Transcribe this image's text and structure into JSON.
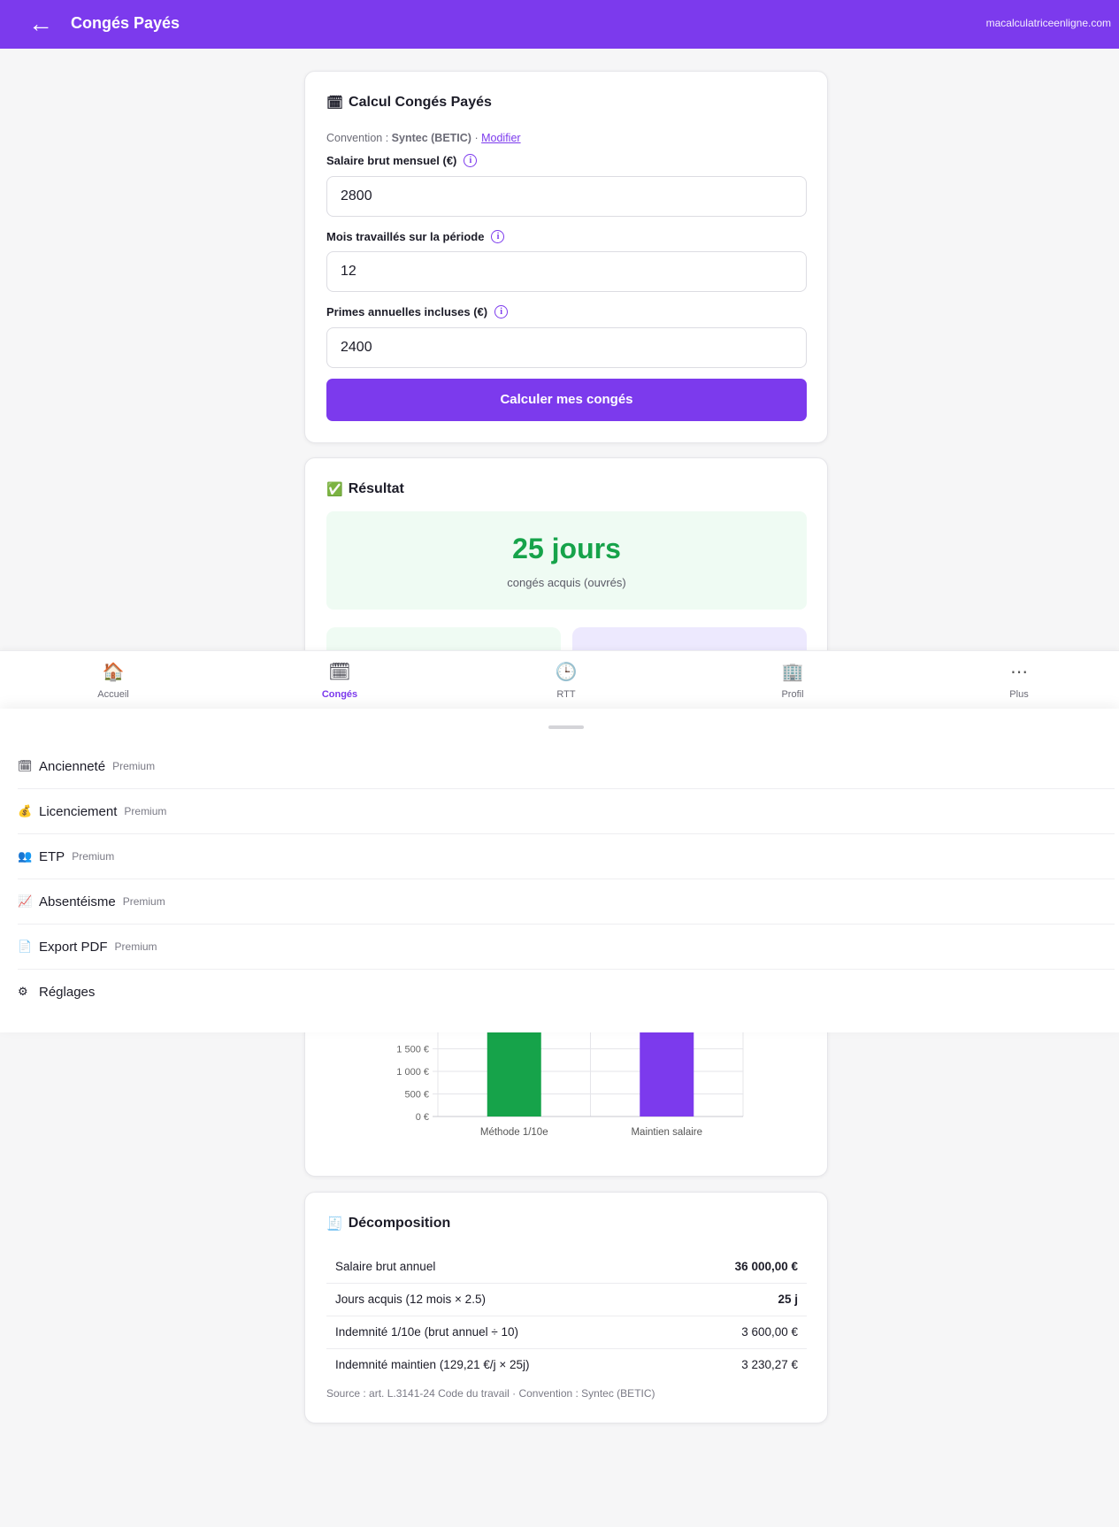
{
  "header": {
    "back_icon": "←",
    "title": "Congés Payés",
    "site": "macalculatriceenligne.com",
    "color": "#7c3aed"
  },
  "form": {
    "icon": "🗓",
    "title": "Calcul Congés Payés",
    "convention_prefix": "Convention :",
    "convention_name": "Syntec (BETIC)",
    "convention_sep": "·",
    "convention_link": "Modifier",
    "fields": [
      {
        "label": "Salaire brut mensuel (€)",
        "value": "2800"
      },
      {
        "label": "Mois travaillés sur la période",
        "value": "12"
      },
      {
        "label": "Primes annuelles incluses (€)",
        "value": "2400"
      }
    ],
    "info_icon": "i",
    "submit_label": "Calculer mes congés"
  },
  "result": {
    "icon": "✅",
    "title": "Résultat",
    "big_value": "25 jours",
    "subtitle": "congés acquis (ouvrés)"
  },
  "bottom_nav": [
    {
      "icon": "🏠",
      "label": "Accueil",
      "active": false
    },
    {
      "icon": "🗓",
      "label": "Congés",
      "active": true
    },
    {
      "icon": "🕒",
      "label": "RTT",
      "active": false
    },
    {
      "icon": "🏢",
      "label": "Profil",
      "active": false
    },
    {
      "icon": "⋯",
      "label": "Plus",
      "active": false
    }
  ],
  "more_menu": [
    {
      "icon": "🗓",
      "label": "Ancienneté",
      "badge": "Premium"
    },
    {
      "icon": "💰",
      "label": "Licenciement",
      "badge": "Premium"
    },
    {
      "icon": "👥",
      "label": "ETP",
      "badge": "Premium"
    },
    {
      "icon": "📈",
      "label": "Absentéisme",
      "badge": "Premium"
    },
    {
      "icon": "📄",
      "label": "Export PDF",
      "badge": "Premium"
    },
    {
      "icon": "⚙",
      "label": "Réglages",
      "badge": ""
    }
  ],
  "chart_data": {
    "type": "bar",
    "categories": [
      "Méthode 1/10e",
      "Maintien salaire"
    ],
    "values": [
      3600,
      3230.27
    ],
    "colors": [
      "#16a34a",
      "#7c3aed"
    ],
    "visible_ticks": [
      {
        "value": 0,
        "label": "0 €"
      },
      {
        "value": 500,
        "label": "500 €"
      },
      {
        "value": 1000,
        "label": "1 000 €"
      },
      {
        "value": 1500,
        "label": "1 500 €"
      }
    ],
    "grid": true
  },
  "decomposition": {
    "icon": "🧾",
    "title": "Décomposition",
    "rows": [
      {
        "label": "Salaire brut annuel",
        "value": "36 000,00 €",
        "bold": true
      },
      {
        "label": "Jours acquis (12 mois × 2.5)",
        "value": "25 j",
        "bold": true
      },
      {
        "label": "Indemnité 1/10e (brut annuel ÷ 10)",
        "value": "3 600,00 €",
        "bold": false
      },
      {
        "label": "Indemnité maintien (129,21 €/j × 25j)",
        "value": "3 230,27 €",
        "bold": false
      }
    ],
    "source": "Source : art. L.3141-24 Code du travail · Convention : Syntec (BETIC)"
  }
}
